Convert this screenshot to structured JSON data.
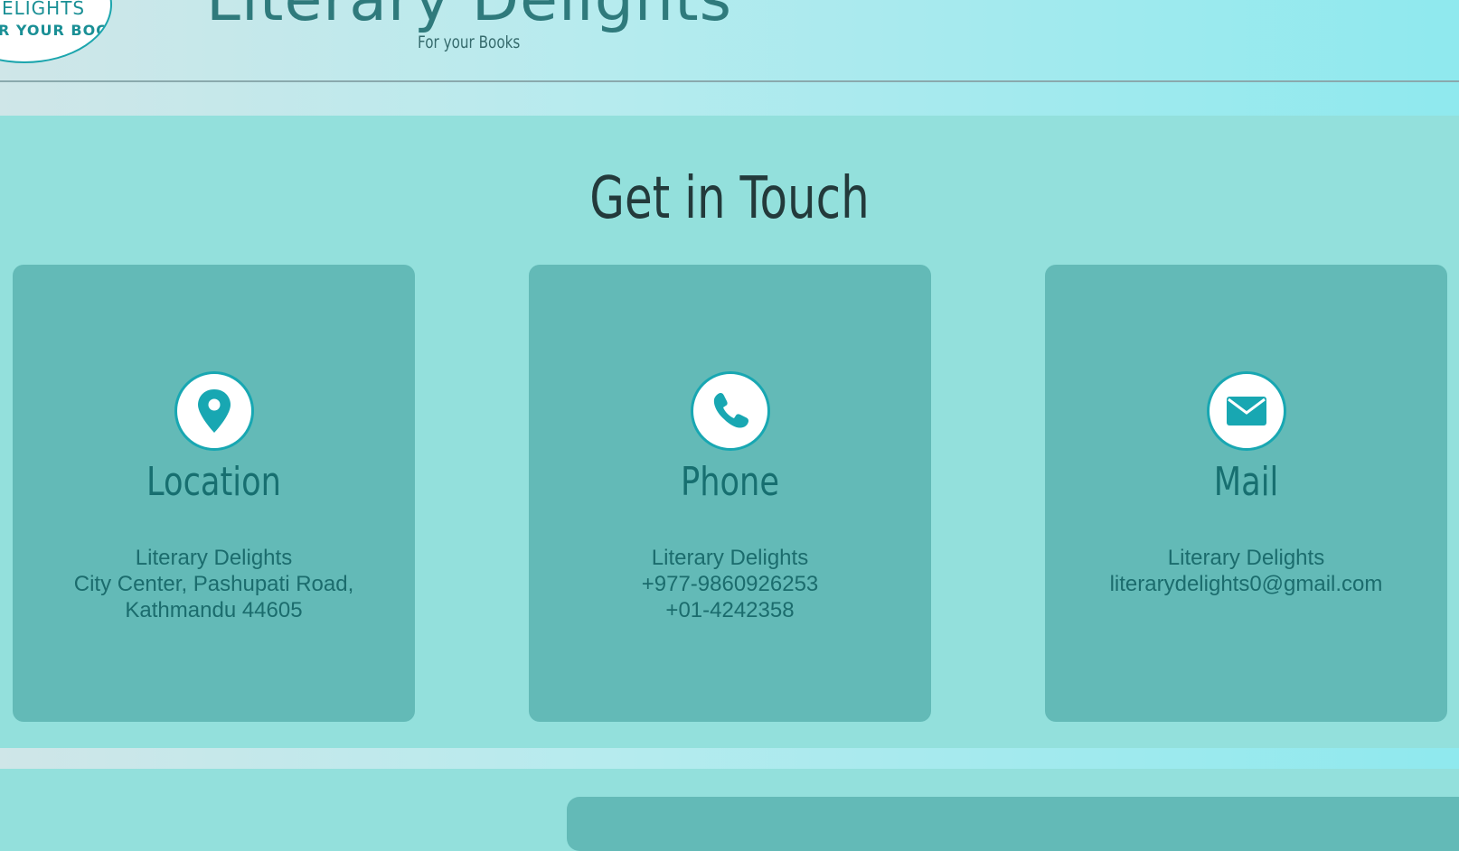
{
  "header": {
    "logo_line1": "ELIGHTS",
    "logo_line2": "R YOUR BOOKS",
    "brand_title": "Literary Delights",
    "tagline": "For your Books"
  },
  "contact": {
    "title": "Get in Touch",
    "cards": [
      {
        "icon": "location-pin-icon",
        "title": "Location",
        "lines": [
          "Literary Delights",
          "City Center, Pashupati Road,",
          "Kathmandu 44605"
        ]
      },
      {
        "icon": "phone-icon",
        "title": "Phone",
        "lines": [
          "Literary Delights",
          "+977-9860926253",
          "+01-4242358"
        ]
      },
      {
        "icon": "mail-icon",
        "title": "Mail",
        "lines": [
          "Literary Delights",
          "literarydelights0@gmail.com"
        ]
      }
    ]
  },
  "colors": {
    "accent": "#18a7b2",
    "card_bg": "#63bab7",
    "section_bg": "#93e0dc",
    "heading_text": "#233a3b",
    "card_text": "#1b6c6d"
  }
}
